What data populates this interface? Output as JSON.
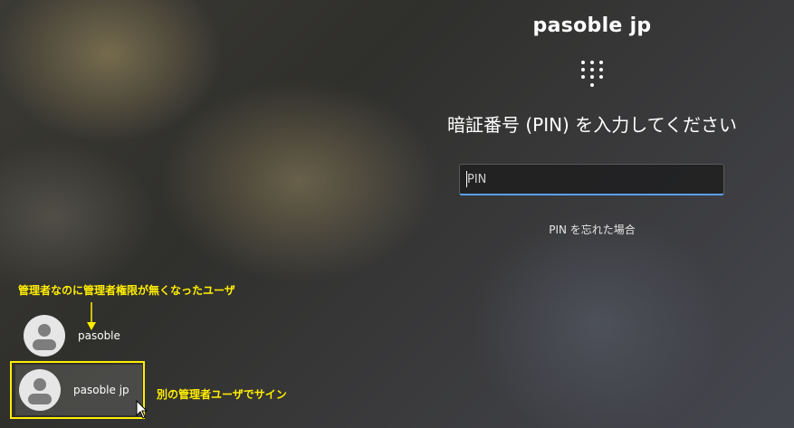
{
  "signin": {
    "user_name": "pasoble jp",
    "prompt": "暗証番号 (PIN) を入力してください",
    "pin_placeholder": "PIN",
    "forgot_pin": "PIN を忘れた場合",
    "icon": "pin-keypad-icon"
  },
  "users": [
    {
      "name": "pasoble",
      "icon": "user-avatar-icon"
    },
    {
      "name": "pasoble jp",
      "icon": "user-avatar-icon",
      "selected": true
    }
  ],
  "annotations": {
    "top_note": "管理者なのに管理者権限が無くなったユーザ",
    "side_note": "別の管理者ユーザでサイン"
  },
  "colors": {
    "annotation": "#ffee00",
    "input_accent": "#5aa0e8"
  }
}
